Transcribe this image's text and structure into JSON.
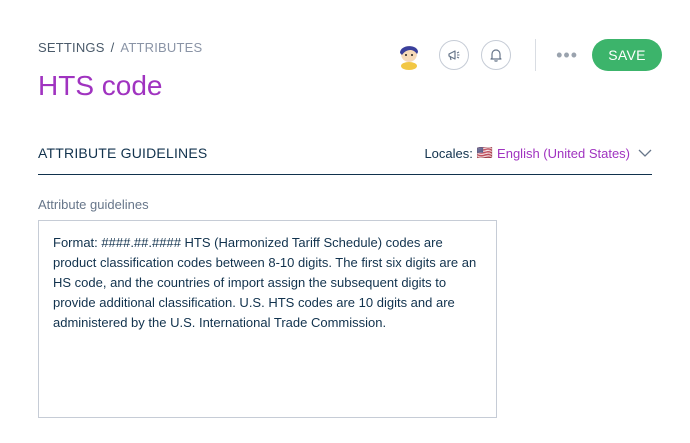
{
  "breadcrumb": {
    "root": "SETTINGS",
    "separator": "/",
    "current": "ATTRIBUTES"
  },
  "page": {
    "title": "HTS code"
  },
  "toolbar": {
    "avatar_icon": "user-avatar-icon",
    "announcements_icon": "megaphone-icon",
    "notifications_icon": "bell-icon",
    "more_label": "•••",
    "save_label": "SAVE",
    "save_color": "#3cb46b"
  },
  "section": {
    "title": "ATTRIBUTE GUIDELINES",
    "locales_label": "Locales:",
    "locale_flag": "🇺🇸",
    "locale_value": "English (United States)"
  },
  "field": {
    "label": "Attribute guidelines",
    "value": "Format: ####.##.#### HTS (Harmonized Tariff Schedule) codes are product classification codes between 8-10 digits. The first six digits are an HS code, and the countries of import assign the subsequent digits to provide additional classification. U.S. HTS codes are 10 digits and are administered by the U.S. International Trade Commission."
  },
  "colors": {
    "accent": "#a033c0",
    "text": "#11324d",
    "muted": "#67768a"
  }
}
